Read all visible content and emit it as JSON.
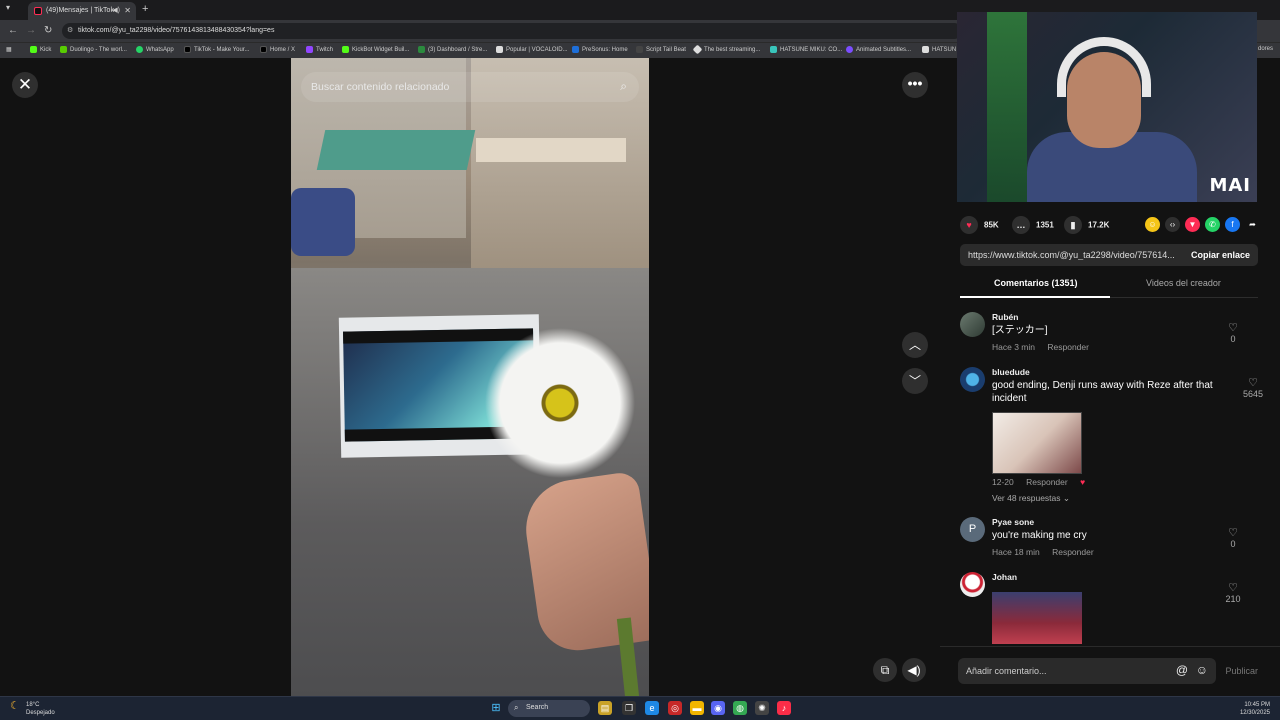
{
  "browser": {
    "tab_title": "(49)Mensajes | TikTok",
    "url": "tiktok.com/@yu_ta2298/video/7576143813488430354?lang=es",
    "bookmarks": [
      {
        "label": "Kick",
        "color": "#53fc18"
      },
      {
        "label": "Duolingo - The worl...",
        "color": "#58cc02"
      },
      {
        "label": "WhatsApp",
        "color": "#25d366"
      },
      {
        "label": "TikTok - Make Your...",
        "color": "#000000"
      },
      {
        "label": "Home / X",
        "color": "#000000"
      },
      {
        "label": "Twitch",
        "color": "#9146ff"
      },
      {
        "label": "KickBot Widget Buil...",
        "color": "#53fc18"
      },
      {
        "label": "(3) Dashboard / Stre...",
        "color": "#2b8a3e"
      },
      {
        "label": "Popular | VOCALOID...",
        "color": "#dddddd"
      },
      {
        "label": "PreSonus: Home",
        "color": "#1e6fd9"
      },
      {
        "label": "Script Tail Beat",
        "color": "#444444"
      },
      {
        "label": "The best streaming...",
        "color": "#dddddd"
      },
      {
        "label": "HATSUNE MIKU: CO...",
        "color": "#39c5bb"
      },
      {
        "label": "Animated Subtitles...",
        "color": "#7b4dff"
      },
      {
        "label": "HATSUN",
        "color": "#dddddd"
      },
      {
        "label": "dores",
        "color": "#35363a"
      }
    ]
  },
  "video": {
    "search_placeholder": "Buscar contenido relacionado"
  },
  "webcam": {
    "overlay_text": "MAI"
  },
  "stats": {
    "likes": "85K",
    "comments": "1351",
    "saves": "17.2K"
  },
  "share": {
    "link": "https://www.tiktok.com/@yu_ta2298/video/757614...",
    "copy_label": "Copiar enlace"
  },
  "tabs": {
    "comments_label": "Comentarios (1351)",
    "creator_label": "Videos del creador"
  },
  "comments": [
    {
      "user": "Rubén",
      "text": "[ステッカー]",
      "time": "Hace 3 min",
      "reply": "Responder",
      "likes": "0"
    },
    {
      "user": "bluedude",
      "text": "good ending, Denji runs away with Reze after that incident",
      "time": "12-20",
      "reply": "Responder",
      "likes": "5645",
      "more_replies": "Ver 48 respuestas"
    },
    {
      "user": "Pyae sone",
      "initial": "P",
      "text": "you're making me cry",
      "time": "Hace 18 min",
      "reply": "Responder",
      "likes": "0"
    },
    {
      "user": "Johan",
      "likes": "210"
    }
  ],
  "composer": {
    "placeholder": "Añadir comentario...",
    "post_label": "Publicar"
  },
  "taskbar": {
    "temp": "18°C",
    "condition": "Despejado",
    "search_label": "Search",
    "time": "10:45 PM",
    "date": "12/30/2025"
  }
}
